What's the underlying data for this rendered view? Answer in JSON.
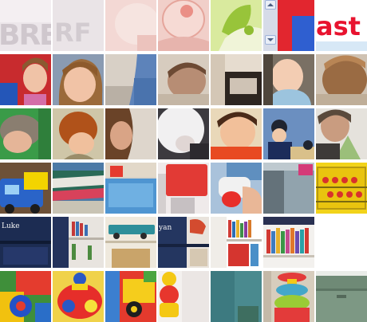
{
  "tiles_row1": {
    "text_1": "BRE",
    "text_2": "RF",
    "text_3": "ast"
  },
  "tiles_row5": {
    "label_luke": "Luke",
    "label_yan": "yan"
  },
  "colors": {
    "background": "#ffffff",
    "tile_gap": "#ffffff",
    "ast_red": "#e8132f"
  },
  "icons": {
    "scroll_up": "scroll-up-icon",
    "scroll_down": "scroll-down-icon"
  }
}
